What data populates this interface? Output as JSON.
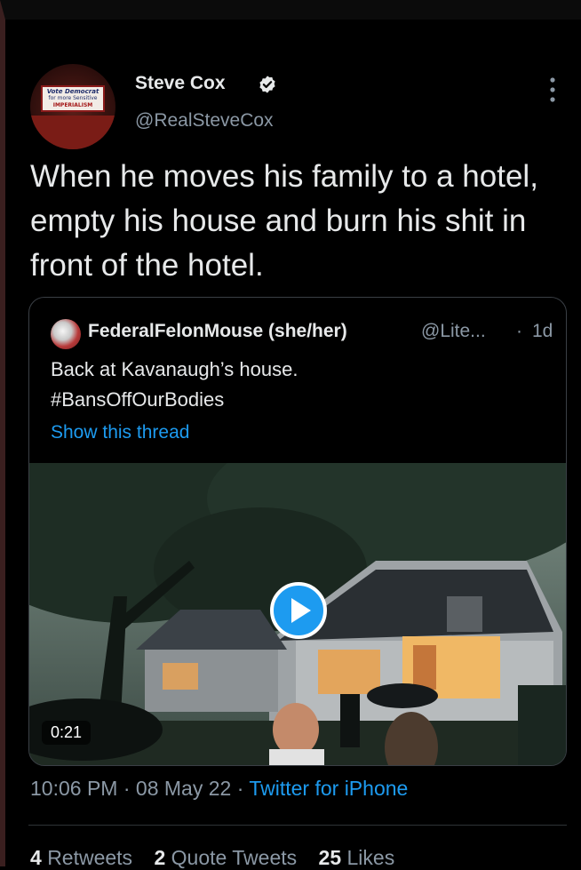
{
  "author": {
    "name": "Steve Cox",
    "handle": "@RealSteveCox",
    "avatar_sticker": [
      "Vote Democrat",
      "for more Sensitive",
      "IMPERIALISM"
    ],
    "verified_icon": "verified-badge-icon",
    "more_icon": "vertical-ellipsis-icon"
  },
  "tweet": {
    "text": "When he moves his family to a hotel, empty his house and burn his shit in front of the hotel."
  },
  "quoted_tweet": {
    "name": "FederalFelonMouse (she/her)",
    "handle": "@Lite...",
    "separator": "·",
    "time": "1d",
    "text_line1": "Back at Kavanaugh’s house.",
    "text_line2": "#BansOffOurBodies",
    "show_thread": "Show this thread",
    "video": {
      "duration": "0:21",
      "play_icon": "play-icon"
    }
  },
  "meta": {
    "time": "10:06 PM",
    "dot1": " · ",
    "date": "08 May 22",
    "dot2": " · ",
    "app": "Twitter for iPhone"
  },
  "stats": {
    "retweets_count": "4",
    "retweets_label": "Retweets",
    "quotes_count": "2",
    "quotes_label": "Quote Tweets",
    "likes_count": "25",
    "likes_label": "Likes"
  },
  "colors": {
    "background": "#000000",
    "text": "#e7e9ea",
    "secondary": "#8b98a5",
    "accent": "#1d9bf0"
  }
}
